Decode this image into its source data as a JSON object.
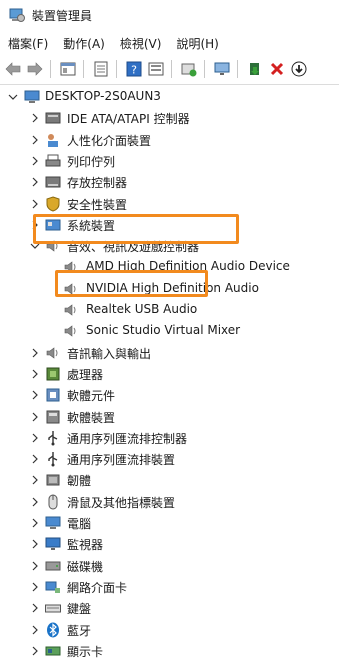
{
  "window": {
    "title": "裝置管理員"
  },
  "menu": [
    "檔案(F)",
    "動作(A)",
    "檢視(V)",
    "說明(H)"
  ],
  "tree": {
    "root": "DESKTOP-2S0AUN3",
    "items": [
      {
        "label": "IDE ATA/ATAPI 控制器",
        "icon": "ide-controller-icon",
        "expanded": false
      },
      {
        "label": "人性化介面裝置",
        "icon": "hid-icon",
        "expanded": false
      },
      {
        "label": "列印佇列",
        "icon": "print-queue-icon",
        "expanded": false
      },
      {
        "label": "存放控制器",
        "icon": "storage-controller-icon",
        "expanded": false
      },
      {
        "label": "安全性裝置",
        "icon": "security-device-icon",
        "expanded": false
      },
      {
        "label": "系統裝置",
        "icon": "system-device-icon",
        "expanded": false
      },
      {
        "label": "音效、視訊及遊戲控制器",
        "icon": "speaker-icon",
        "expanded": true,
        "highlight": true,
        "children": [
          {
            "label": "AMD High Definition Audio Device",
            "icon": "speaker-icon"
          },
          {
            "label": "NVIDIA High Definition Audio",
            "icon": "speaker-icon"
          },
          {
            "label": "Realtek USB Audio",
            "icon": "speaker-icon",
            "highlight": true
          },
          {
            "label": "Sonic Studio Virtual Mixer",
            "icon": "speaker-icon"
          }
        ]
      },
      {
        "label": "音訊輸入與輸出",
        "icon": "speaker-icon",
        "expanded": false
      },
      {
        "label": "處理器",
        "icon": "processor-icon",
        "expanded": false
      },
      {
        "label": "軟體元件",
        "icon": "software-component-icon",
        "expanded": false
      },
      {
        "label": "軟體裝置",
        "icon": "software-device-icon",
        "expanded": false
      },
      {
        "label": "通用序列匯流排控制器",
        "icon": "usb-icon",
        "expanded": false
      },
      {
        "label": "通用序列匯流排裝置",
        "icon": "usb-icon",
        "expanded": false
      },
      {
        "label": "韌體",
        "icon": "firmware-icon",
        "expanded": false
      },
      {
        "label": "滑鼠及其他指標裝置",
        "icon": "mouse-icon",
        "expanded": false
      },
      {
        "label": "電腦",
        "icon": "computer-icon",
        "expanded": false
      },
      {
        "label": "監視器",
        "icon": "monitor-icon",
        "expanded": false
      },
      {
        "label": "磁碟機",
        "icon": "disk-drive-icon",
        "expanded": false
      },
      {
        "label": "網路介面卡",
        "icon": "network-adapter-icon",
        "expanded": false
      },
      {
        "label": "鍵盤",
        "icon": "keyboard-icon",
        "expanded": false
      },
      {
        "label": "藍牙",
        "icon": "bluetooth-icon",
        "expanded": false
      },
      {
        "label": "顯示卡",
        "icon": "display-adapter-icon",
        "expanded": false
      }
    ]
  },
  "colors": {
    "highlight": "#f28a1e",
    "accent": "#1a73c8",
    "delete": "#d42020"
  }
}
